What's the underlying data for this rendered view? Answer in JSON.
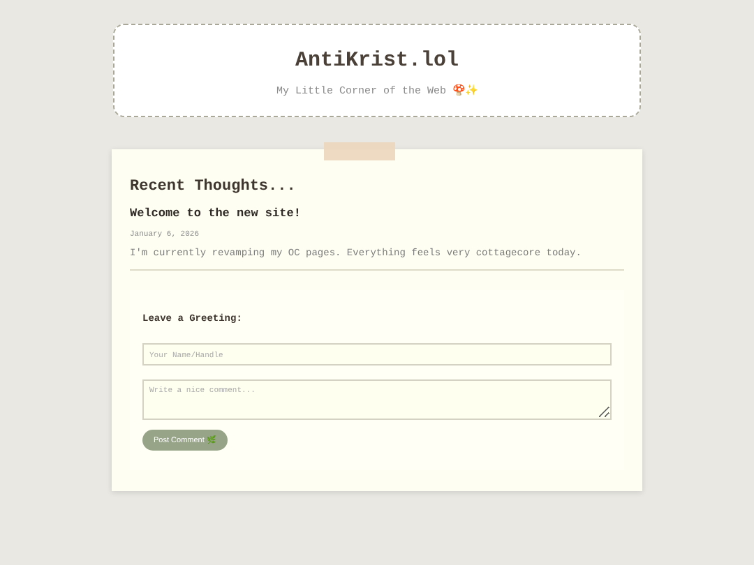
{
  "header": {
    "title": "AntiKrist.lol",
    "tagline": "My Little Corner of the Web 🍄✨"
  },
  "section_title": "Recent Thoughts...",
  "post": {
    "title": "Welcome to the new site!",
    "date": "January 6, 2026",
    "body": "I'm currently revamping my OC pages. Everything feels very cottagecore today."
  },
  "greeting_form": {
    "title": "Leave a Greeting:",
    "name_field": {
      "placeholder": "Your Name/Handle"
    },
    "comment_field": {
      "placeholder": "Write a nice comment..."
    },
    "submit_button": "Post Comment 🌿"
  }
}
